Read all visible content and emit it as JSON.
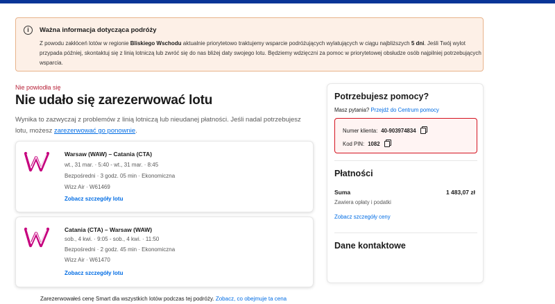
{
  "alert": {
    "title": "Ważna informacja dotycząca podróży",
    "body_1": "Z powodu zakłóceń lotów w regionie ",
    "body_bold_region": "Bliskiego Wschodu",
    "body_2": " aktualnie priorytetowo traktujemy wsparcie podróżujących wylatujących w ciągu najbliższych ",
    "body_bold_days": "5 dni",
    "body_3": ". Jeśli Twój wylot przypada później, skontaktuj się z linią lotniczą lub zwróć się do nas bliżej daty swojego lotu. Będziemy wdzięczni za pomoc w priorytetowej obsłudze osób najpilniej potrzebujących wsparcia."
  },
  "error": {
    "label": "Nie powiodła się",
    "title": "Nie udało się zarezerwować lotu",
    "desc_1": "Wynika to zazwyczaj z problemów z linią lotniczą lub nieudanej płatności. Jeśli nadal potrzebujesz lotu, możesz ",
    "desc_link": "zarezerwować go ponownie",
    "desc_2": "."
  },
  "flights": [
    {
      "route": "Warsaw (WAW) – Catania (CTA)",
      "times": "wt., 31 mar. · 5:40 - wt., 31 mar. · 8:45",
      "info": "Bezpośredni · 3 godz. 05 min · Ekonomiczna",
      "airline": "Wizz Air · W61469",
      "details_link": "Zobacz szczegóły lotu"
    },
    {
      "route": "Catania (CTA) – Warsaw (WAW)",
      "times": "sob., 4 kwi. · 9:05 - sob., 4 kwi. · 11:50",
      "info": "Bezpośredni · 2 godz. 45 min · Ekonomiczna",
      "airline": "Wizz Air · W61470",
      "details_link": "Zobacz szczegóły lotu"
    }
  ],
  "help": {
    "title": "Potrzebujesz pomocy?",
    "question": "Masz pytania?",
    "help_center_link": "Przejdź do Centrum pomocy",
    "customer_number_label": "Numer klienta:",
    "customer_number": "40-903974834",
    "pin_label": "Kod PIN:",
    "pin": "1082"
  },
  "payments": {
    "title": "Płatności",
    "sum_label": "Suma",
    "sum_value": "1 483,07 zł",
    "sum_note": "Zawiera opłaty i podatki",
    "price_details_link": "Zobacz szczegóły ceny"
  },
  "contact": {
    "title": "Dane kontaktowe"
  },
  "footer": {
    "note": "Zarezerwowałeś cenę Smart dla wszystkich lotów podczas tej podróży. ",
    "link": "Zobacz, co obejmuje ta cena"
  },
  "colors": {
    "brand_bar": "#0a3597",
    "link": "#006ce4",
    "error": "#b8233a",
    "wizz_logo": "#c6007e"
  },
  "icons": [
    "info-icon",
    "copy-icon",
    "wizz-air-logo"
  ]
}
